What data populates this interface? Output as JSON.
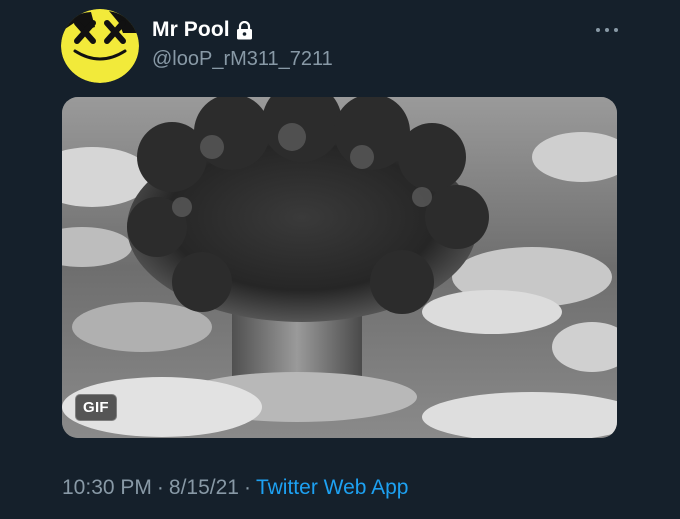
{
  "user": {
    "display_name": "Mr Pool",
    "handle": "@looP_rM311_7211",
    "avatar_icon": "smiley-x-eyes-icon",
    "protected_icon": "lock-icon"
  },
  "menu": {
    "more_icon": "more-horizontal-icon"
  },
  "media": {
    "badge": "GIF",
    "subject": "mushroom cloud explosion"
  },
  "meta": {
    "time": "10:30 PM",
    "date": "8/15/21",
    "separator": "·",
    "source": "Twitter Web App"
  },
  "colors": {
    "background": "#15202b",
    "secondary_text": "#8899a6",
    "link": "#1da1f2",
    "avatar_yellow": "#f2ea3a"
  }
}
